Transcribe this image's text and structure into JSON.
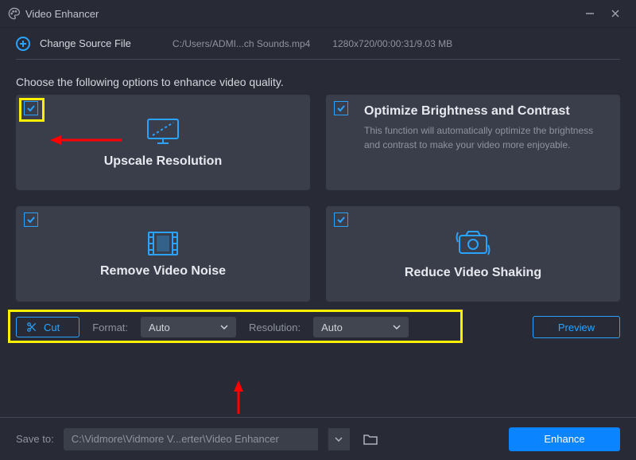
{
  "window": {
    "title": "Video Enhancer"
  },
  "toolbar": {
    "change_label": "Change Source File",
    "path": "C:/Users/ADMI...ch Sounds.mp4",
    "meta": "1280x720/00:00:31/9.03 MB"
  },
  "prompt": "Choose the following options to enhance video quality.",
  "cards": {
    "upscale": {
      "title": "Upscale Resolution"
    },
    "brightness": {
      "title": "Optimize Brightness and Contrast",
      "desc": "This function will automatically optimize the brightness and contrast to make your video more enjoyable."
    },
    "noise": {
      "title": "Remove Video Noise"
    },
    "shake": {
      "title": "Reduce Video Shaking"
    }
  },
  "controls": {
    "cut_label": "Cut",
    "format_label": "Format:",
    "format_value": "Auto",
    "resolution_label": "Resolution:",
    "resolution_value": "Auto",
    "preview_label": "Preview"
  },
  "footer": {
    "save_label": "Save to:",
    "save_path": "C:\\Vidmore\\Vidmore V...erter\\Video Enhancer",
    "enhance_label": "Enhance"
  }
}
